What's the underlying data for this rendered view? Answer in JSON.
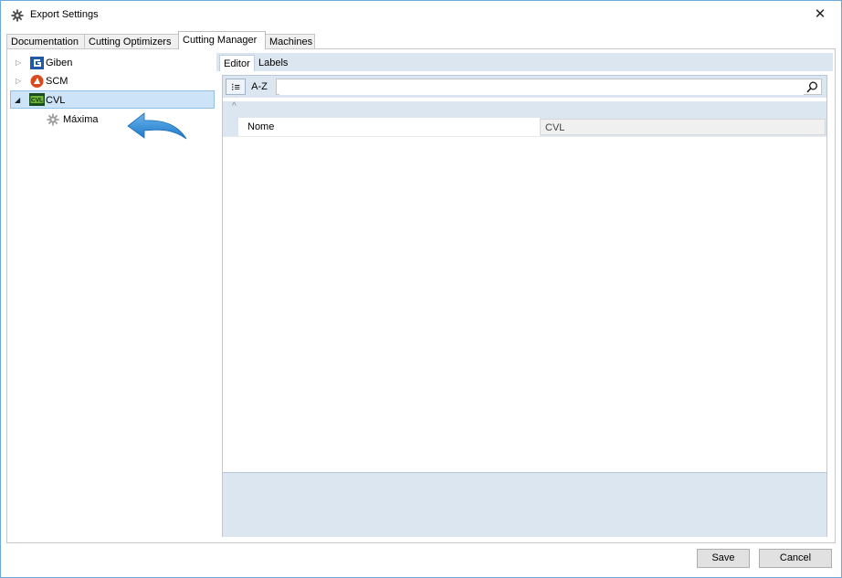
{
  "window": {
    "title": "Export Settings",
    "close_glyph": "✕"
  },
  "tabs": [
    {
      "label": "Documentation",
      "active": false
    },
    {
      "label": "Cutting Optimizers",
      "active": false
    },
    {
      "label": "Cutting Manager",
      "active": true
    },
    {
      "label": "Machines",
      "active": false
    }
  ],
  "tree": {
    "items": [
      {
        "label": "Giben",
        "expander": "▷",
        "icon": "giben-logo-icon"
      },
      {
        "label": "SCM",
        "expander": "▷",
        "icon": "scm-logo-icon"
      },
      {
        "label": "CVL",
        "expander": "◢",
        "icon": "cvl-logo-icon",
        "selected": true
      },
      {
        "label": "Máxima",
        "icon": "gear-icon",
        "child_of": "CVL"
      }
    ]
  },
  "editor": {
    "tabs": [
      {
        "label": "Editor",
        "active": true
      },
      {
        "label": "Labels",
        "active": false
      }
    ],
    "toolbar": {
      "categorized_label": "⁝≡",
      "alphabetical_label": "A-Z",
      "search_value": "",
      "search_placeholder": ""
    },
    "category_caret": "^",
    "properties": [
      {
        "name": "Nome",
        "value": "CVL"
      }
    ]
  },
  "footer": {
    "save_label": "Save",
    "cancel_label": "Cancel"
  },
  "colors": {
    "accent": "#3d8fd6",
    "selection": "#cde4f8",
    "panel": "#dbe6f1",
    "giben_blue": "#1e5aa8",
    "scm_red": "#d94a1e",
    "cvl_green": "#2e7d32"
  }
}
